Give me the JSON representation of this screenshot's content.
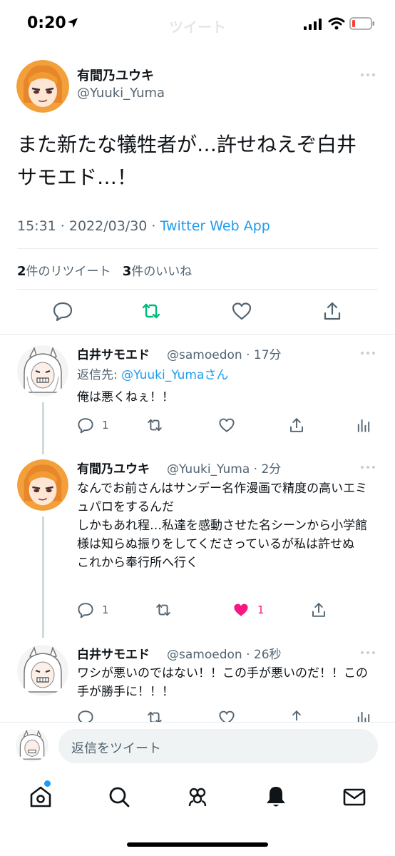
{
  "status_bar": {
    "time": "0:20",
    "ghost_title": "ツイート"
  },
  "main_tweet": {
    "author_name": "有間乃ユウキ",
    "author_handle": "@Yuuki_Yuma",
    "text": "また新たな犠牲者が…許せねえぞ白井サモエド…！",
    "time": "15:31 · 2022/03/30 · ",
    "source": "Twitter Web App",
    "retweet_count": "2",
    "retweet_label": "件のリツイート",
    "like_count": "3",
    "like_label": "件のいいね"
  },
  "replies": [
    {
      "author_name": "白井サモエド",
      "author_handle": "@samoedon · 17分",
      "reply_to_prefix": "返信先: ",
      "reply_to_mention": "@Yuuki_Yuma",
      "reply_to_suffix": "さん",
      "text": "俺は悪くねぇ！！",
      "reply_count": "1",
      "like_count": ""
    },
    {
      "author_name": "有間乃ユウキ",
      "author_handle": "@Yuuki_Yuma · 2分",
      "text": "なんでお前さんはサンデー名作漫画で精度の高いエミュパロをするんだ\nしかもあれ程…私達を感動させた名シーンから小学館様は知らぬ振りをしてくださっているが私は許せぬ\nこれから奉行所へ行く",
      "reply_count": "1",
      "like_count": "1"
    },
    {
      "author_name": "白井サモエド",
      "author_handle": "@samoedon · 26秒",
      "text": "ワシが悪いのではない！！この手が悪いのだ！！この手が勝手に！！！"
    }
  ],
  "composer": {
    "placeholder": "返信をツイート"
  },
  "colors": {
    "accent": "#1d9bf0",
    "retweet": "#00ba7c",
    "like": "#f91880"
  }
}
